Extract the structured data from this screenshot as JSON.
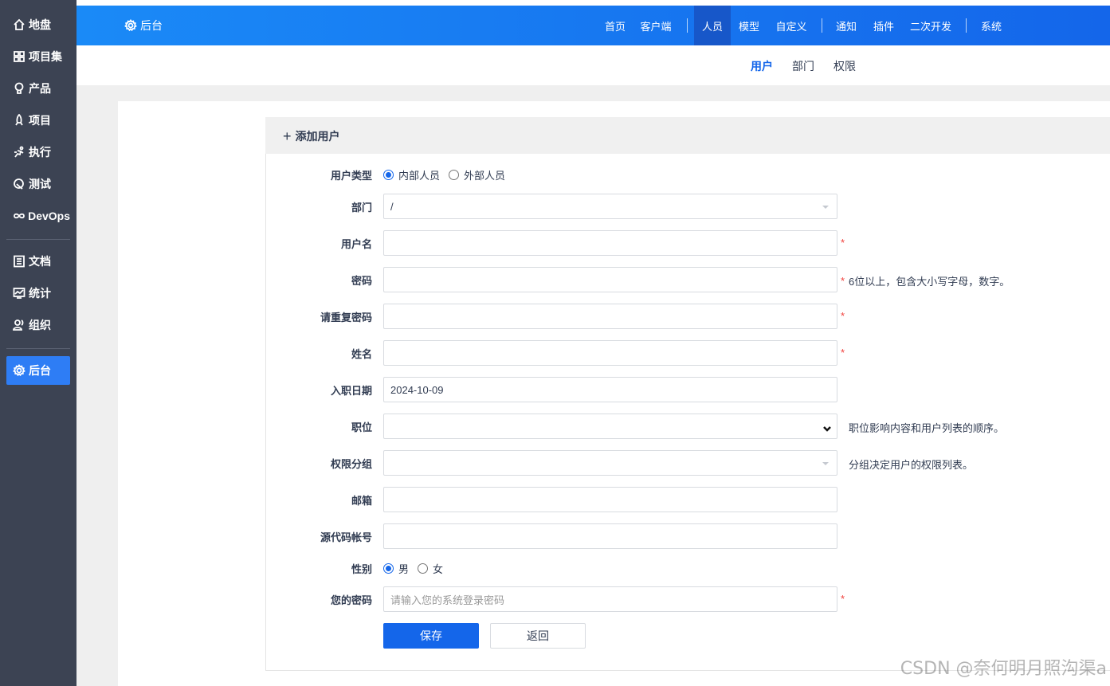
{
  "sidebar": {
    "items": [
      {
        "label": "地盘",
        "icon": "home-icon"
      },
      {
        "label": "项目集",
        "icon": "grid-icon"
      },
      {
        "label": "产品",
        "icon": "lightbulb-icon"
      },
      {
        "label": "项目",
        "icon": "rocket-icon"
      },
      {
        "label": "执行",
        "icon": "run-icon"
      },
      {
        "label": "测试",
        "icon": "test-icon"
      },
      {
        "label": "DevOps",
        "icon": "infinity-icon"
      },
      {
        "label": "文档",
        "icon": "doc-icon"
      },
      {
        "label": "统计",
        "icon": "chart-icon"
      },
      {
        "label": "组织",
        "icon": "users-icon"
      },
      {
        "label": "后台",
        "icon": "gear-icon",
        "active": true
      }
    ]
  },
  "header": {
    "brand": "后台",
    "nav": [
      "首页",
      "客户端",
      "人员",
      "模型",
      "自定义",
      "通知",
      "插件",
      "二次开发",
      "系统"
    ],
    "active": "人员"
  },
  "subnav": {
    "items": [
      "用户",
      "部门",
      "权限"
    ],
    "active": "用户"
  },
  "form": {
    "title": "添加用户",
    "fields": {
      "user_type": {
        "label": "用户类型",
        "options": [
          "内部人员",
          "外部人员"
        ],
        "selected": "内部人员"
      },
      "dept": {
        "label": "部门",
        "value": "/"
      },
      "username": {
        "label": "用户名",
        "value": ""
      },
      "password": {
        "label": "密码",
        "value": "",
        "hint": "6位以上，包含大小写字母，数字。"
      },
      "password_repeat": {
        "label": "请重复密码",
        "value": ""
      },
      "realname": {
        "label": "姓名",
        "value": ""
      },
      "join_date": {
        "label": "入职日期",
        "value": "2024-10-09"
      },
      "role": {
        "label": "职位",
        "value": "",
        "hint": "职位影响内容和用户列表的顺序。"
      },
      "group": {
        "label": "权限分组",
        "value": "",
        "hint": "分组决定用户的权限列表。"
      },
      "email": {
        "label": "邮箱",
        "value": ""
      },
      "commiter": {
        "label": "源代码帐号",
        "value": ""
      },
      "gender": {
        "label": "性别",
        "options": [
          "男",
          "女"
        ],
        "selected": "男"
      },
      "verify_password": {
        "label": "您的密码",
        "placeholder": "请输入您的系统登录密码"
      }
    },
    "required_mark": "*",
    "save_label": "保存",
    "back_label": "返回"
  },
  "watermark": "CSDN @奈何明月照沟渠a",
  "colors": {
    "primary": "#1466ea",
    "sidebar_bg": "#3c4353",
    "required": "#f1413d"
  }
}
